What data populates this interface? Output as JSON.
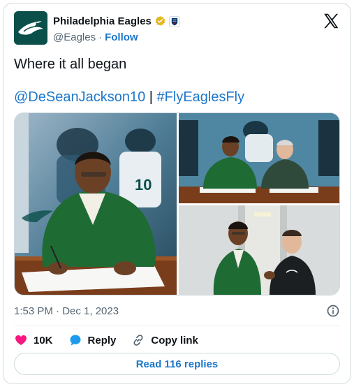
{
  "author": {
    "display_name": "Philadelphia Eagles",
    "handle": "@Eagles",
    "separator": "·",
    "follow_label": "Follow",
    "avatar_color": "#0b4f4a",
    "verified_badge": "gold-check-badge",
    "affiliation_badge": "nfl-shield-badge"
  },
  "tweet": {
    "text": "Where it all began",
    "mention": "@DeSeanJackson10",
    "link_separator": "|",
    "hashtag": "#FlyEaglesFly",
    "timestamp": "1:53 PM · Dec 1, 2023"
  },
  "media": {
    "photos": [
      {
        "subject": "player-signing-contract"
      },
      {
        "subject": "player-signing-with-owner"
      },
      {
        "subject": "player-with-coach"
      }
    ]
  },
  "actions": {
    "likes_count": "10K",
    "reply_label": "Reply",
    "copy_link_label": "Copy link",
    "read_replies_label": "Read 116 replies"
  },
  "colors": {
    "link": "#1d77c9",
    "like_heart": "#f91880",
    "reply_bubble": "#1d9bf0",
    "verified_gold": "#e2b719",
    "border": "#cfd9de",
    "muted_text": "#536471"
  }
}
